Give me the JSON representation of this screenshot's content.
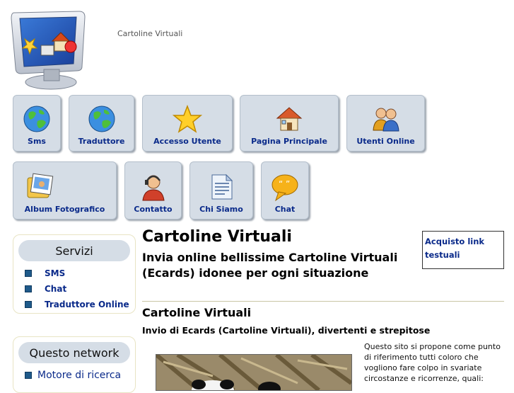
{
  "header": {
    "site_name": "Cartoline Virtuali"
  },
  "nav": {
    "row1": [
      {
        "label": "Sms",
        "icon": "globe-icon"
      },
      {
        "label": "Traduttore",
        "icon": "globe-icon"
      },
      {
        "label": "Accesso Utente",
        "icon": "star-icon"
      },
      {
        "label": "Pagina Principale",
        "icon": "home-icon"
      },
      {
        "label": "Utenti Online",
        "icon": "users-icon"
      }
    ],
    "row2": [
      {
        "label": "Album Fotografico",
        "icon": "photo-album-icon"
      },
      {
        "label": "Contatto",
        "icon": "support-agent-icon"
      },
      {
        "label": "Chi Siamo",
        "icon": "document-icon"
      },
      {
        "label": "Chat",
        "icon": "speech-bubble-icon"
      }
    ]
  },
  "sidebar": {
    "servizi": {
      "title": "Servizi",
      "items": [
        "SMS",
        "Chat",
        "Traduttore Online"
      ]
    },
    "network": {
      "title": "Questo network",
      "items": [
        "Motore di ricerca"
      ]
    }
  },
  "main": {
    "title": "Cartoline Virtuali",
    "subtitle": "Invia online bellissime Cartoline Virtuali (Ecards) idonee per ogni situazione",
    "section_title": "Cartoline Virtuali",
    "section_sub": "Invio di Ecards (Cartoline Virtuali), divertenti e strepitose",
    "paragraph": "Questo sito si propone come punto di riferimento tutti coloro che vogliono fare colpo in svariate circostanze e ricorrenze, quali:"
  },
  "ad": {
    "label": "Acquisto link testuali"
  },
  "colors": {
    "nav_bg": "#d5dde6",
    "link": "#0a2a8a",
    "bullet": "#1f5a8a"
  }
}
